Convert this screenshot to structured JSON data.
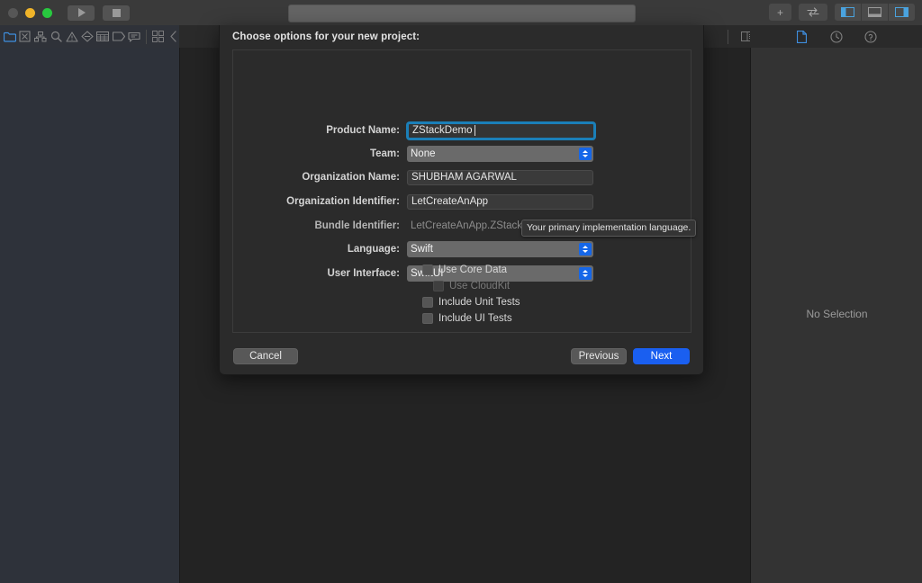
{
  "window": {
    "traffic_lights": [
      "close-disabled",
      "minimize",
      "zoom"
    ],
    "run_button_icon": "play-icon",
    "stop_button_icon": "stop-icon",
    "activity_view_text": "",
    "add_button_label": "+",
    "toggle_button_icon": "swap-arrows-icon",
    "pane_toggles": [
      "left-panel-icon",
      "bottom-panel-icon",
      "right-panel-icon"
    ]
  },
  "navigator_bar": {
    "icons": [
      {
        "name": "project-navigator-icon",
        "label": "Project"
      },
      {
        "name": "source-control-navigator-icon",
        "label": "Source Control"
      },
      {
        "name": "symbol-navigator-icon",
        "label": "Symbol"
      },
      {
        "name": "find-navigator-icon",
        "label": "Find"
      },
      {
        "name": "issue-navigator-icon",
        "label": "Issue"
      },
      {
        "name": "test-navigator-icon",
        "label": "Test"
      },
      {
        "name": "debug-navigator-icon",
        "label": "Debug"
      },
      {
        "name": "breakpoint-navigator-icon",
        "label": "Breakpoint"
      },
      {
        "name": "report-navigator-icon",
        "label": "Report"
      }
    ],
    "filter_icon": "grid-icon",
    "collapse_icon": "chevron-left-icon",
    "editor_layout_icon": "assistant-editor-icon",
    "inspector_icons": [
      {
        "name": "file-inspector-icon",
        "active": true
      },
      {
        "name": "history-inspector-icon",
        "active": false
      },
      {
        "name": "quick-help-inspector-icon",
        "active": false
      }
    ]
  },
  "inspector": {
    "empty_text": "No Selection"
  },
  "dialog": {
    "title": "Choose options for your new project:",
    "fields": [
      {
        "id": "product-name",
        "label": "Product Name:",
        "value": "ZStackDemo ",
        "type": "textfield",
        "focused": true
      },
      {
        "id": "team",
        "label": "Team:",
        "value": "None",
        "type": "popup",
        "focused": false
      },
      {
        "id": "organization-name",
        "label": "Organization Name:",
        "value": "SHUBHAM AGARWAL",
        "type": "textfield",
        "focused": false
      },
      {
        "id": "organization-identifier",
        "label": "Organization Identifier:",
        "value": "LetCreateAnApp",
        "type": "textfield",
        "focused": false
      },
      {
        "id": "bundle-identifier",
        "label": "Bundle Identifier:",
        "value": "LetCreateAnApp.ZStackDemo",
        "type": "readonly",
        "focused": false
      },
      {
        "id": "language",
        "label": "Language:",
        "value": "Swift",
        "type": "popup",
        "focused": false
      },
      {
        "id": "user-interface",
        "label": "User Interface:",
        "value": "SwiftUI",
        "type": "popup",
        "focused": false
      }
    ],
    "tooltip": "Your primary implementation language.",
    "checkboxes": [
      {
        "id": "use-core-data",
        "label": "Use Core Data",
        "checked": false,
        "disabled": false,
        "indent": false
      },
      {
        "id": "use-cloudkit",
        "label": "Use CloudKit",
        "checked": false,
        "disabled": true,
        "indent": true
      },
      {
        "id": "include-unit-tests",
        "label": "Include Unit Tests",
        "checked": false,
        "disabled": false,
        "indent": false
      },
      {
        "id": "include-ui-tests",
        "label": "Include UI Tests",
        "checked": false,
        "disabled": false,
        "indent": false
      }
    ],
    "buttons": {
      "cancel": "Cancel",
      "previous": "Previous",
      "next": "Next"
    }
  },
  "colors": {
    "accent_blue": "#1a5ff0",
    "focus_ring": "#1b7fb8",
    "popup_arrow_blue": "#1667e8",
    "sheet_bg": "#2b2b2b",
    "editor_bg": "#232323",
    "navigator_bg": "#2e323a",
    "inspector_bg": "#333333",
    "titlebar_bg": "#3a3a3a",
    "traffic_yellow": "#f0b429",
    "traffic_green": "#28c93f",
    "traffic_gray": "#565656"
  }
}
